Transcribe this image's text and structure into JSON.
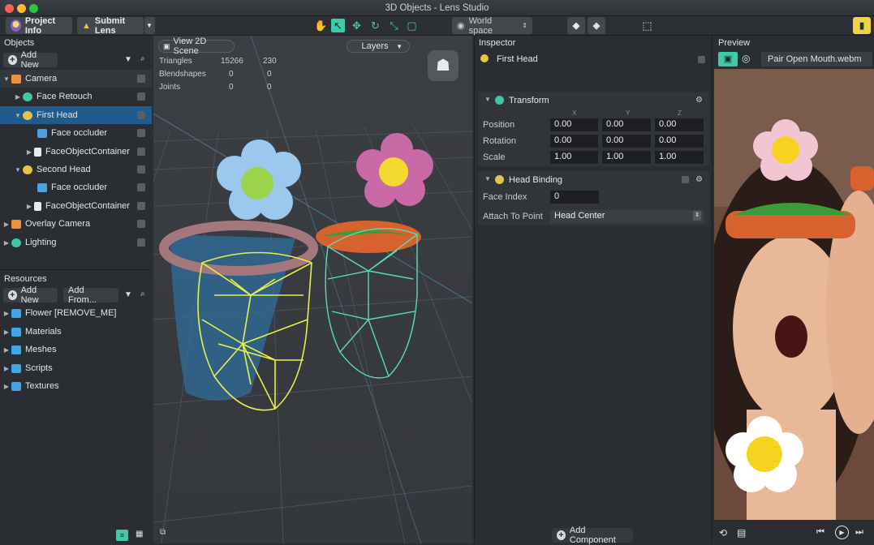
{
  "window": {
    "title": "3D Objects - Lens Studio"
  },
  "toolbar": {
    "project_info": "Project Info",
    "submit_lens": "Submit Lens",
    "space": "World space"
  },
  "objects_panel": {
    "title": "Objects",
    "add_new": "Add New",
    "items": [
      {
        "label": "Camera",
        "icon": "camera-icon",
        "color": "#f0923a"
      },
      {
        "label": "Face Retouch",
        "icon": "face-retouch-icon",
        "color": "#45c4a6"
      },
      {
        "label": "First Head",
        "icon": "head-binding-icon",
        "color": "#e6c34a"
      },
      {
        "label": "Face occluder",
        "icon": "mesh-icon",
        "color": "#4aa3e0"
      },
      {
        "label": "FaceObjectContainer",
        "icon": "file-icon",
        "color": "#e8eaec"
      },
      {
        "label": "Second Head",
        "icon": "head-binding-icon",
        "color": "#e6c34a"
      },
      {
        "label": "Face occluder",
        "icon": "mesh-icon",
        "color": "#4aa3e0"
      },
      {
        "label": "FaceObjectContainer",
        "icon": "file-icon",
        "color": "#e8eaec"
      },
      {
        "label": "Overlay Camera",
        "icon": "camera-icon",
        "color": "#f0923a"
      },
      {
        "label": "Lighting",
        "icon": "lighting-icon",
        "color": "#45c4a6"
      }
    ]
  },
  "resources_panel": {
    "title": "Resources",
    "add_new": "Add New",
    "add_from": "Add From...",
    "items": [
      {
        "label": "Flower [REMOVE_ME]"
      },
      {
        "label": "Materials"
      },
      {
        "label": "Meshes"
      },
      {
        "label": "Scripts"
      },
      {
        "label": "Textures"
      }
    ]
  },
  "viewport": {
    "view_2d": "View 2D Scene",
    "layers": "Layers",
    "stats": [
      {
        "label": "Triangles",
        "a": "15266",
        "b": "230"
      },
      {
        "label": "Blendshapes",
        "a": "0",
        "b": "0"
      },
      {
        "label": "Joints",
        "a": "0",
        "b": "0"
      }
    ]
  },
  "inspector": {
    "title": "Inspector",
    "object_name": "First Head",
    "transform": {
      "title": "Transform",
      "axes": [
        "X",
        "Y",
        "Z"
      ],
      "rows": [
        {
          "label": "Position",
          "values": [
            "0.00",
            "0.00",
            "0.00"
          ]
        },
        {
          "label": "Rotation",
          "values": [
            "0.00",
            "0.00",
            "0.00"
          ]
        },
        {
          "label": "Scale",
          "values": [
            "1.00",
            "1.00",
            "1.00"
          ]
        }
      ]
    },
    "head_binding": {
      "title": "Head Binding",
      "face_index_label": "Face Index",
      "face_index": "0",
      "attach_label": "Attach To Point",
      "attach_value": "Head Center"
    },
    "add_component": "Add Component"
  },
  "preview": {
    "title": "Preview",
    "media": "Pair Open Mouth.webm"
  },
  "colors": {
    "accent": "#3fc9a8",
    "selection": "#1f5b8c",
    "wire_yellow": "#e8f04a",
    "wire_teal": "#5fd9b8"
  }
}
